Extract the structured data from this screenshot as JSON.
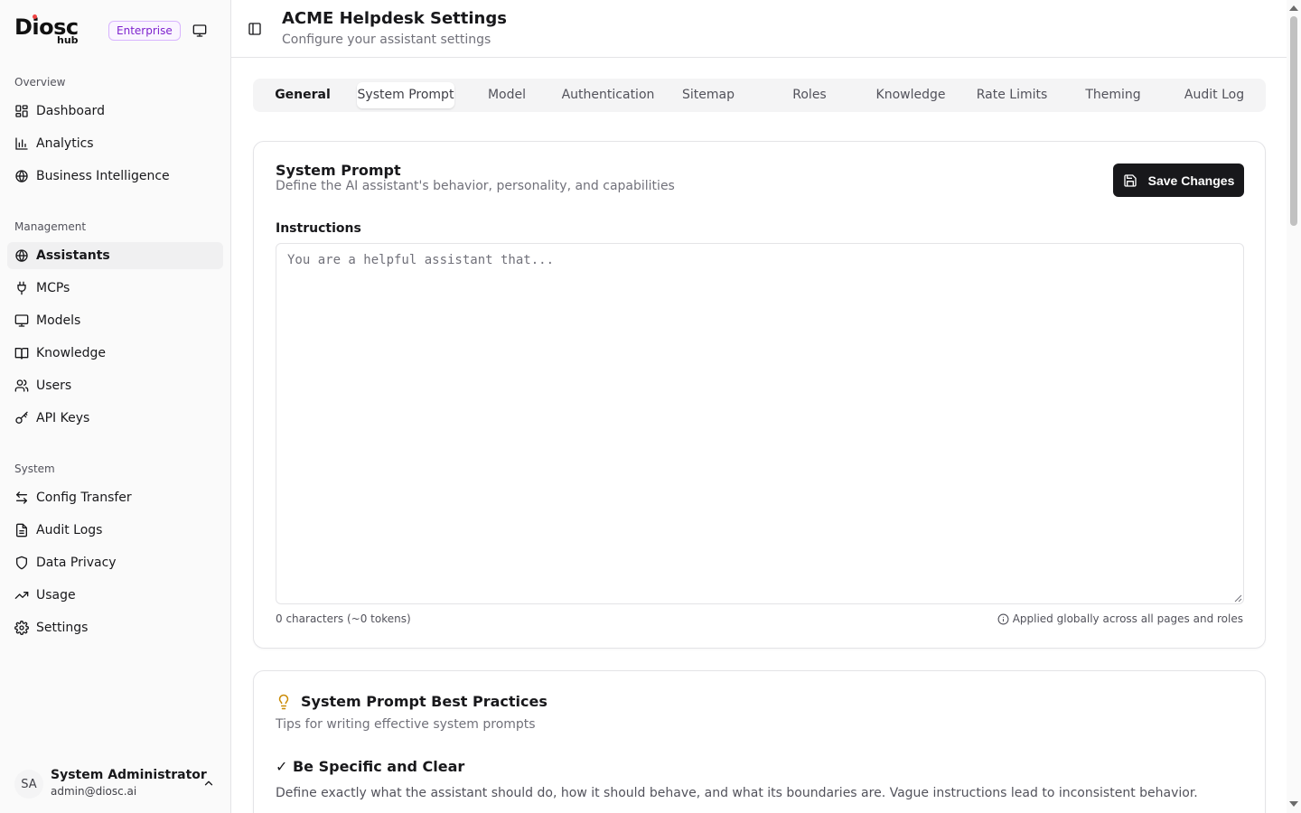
{
  "brand": {
    "name": "Diosc",
    "sub": "hub",
    "edition": "Enterprise"
  },
  "sidebar": {
    "sections": [
      {
        "label": "Overview",
        "items": [
          {
            "label": "Dashboard",
            "icon": "dashboard-icon"
          },
          {
            "label": "Analytics",
            "icon": "bar-chart-icon"
          },
          {
            "label": "Business Intelligence",
            "icon": "globe-icon"
          }
        ]
      },
      {
        "label": "Management",
        "items": [
          {
            "label": "Assistants",
            "icon": "globe-icon",
            "active": true
          },
          {
            "label": "MCPs",
            "icon": "plug-icon"
          },
          {
            "label": "Models",
            "icon": "monitor-icon"
          },
          {
            "label": "Knowledge",
            "icon": "book-icon"
          },
          {
            "label": "Users",
            "icon": "users-icon"
          },
          {
            "label": "API Keys",
            "icon": "key-icon"
          }
        ]
      },
      {
        "label": "System",
        "items": [
          {
            "label": "Config Transfer",
            "icon": "transfer-icon"
          },
          {
            "label": "Audit Logs",
            "icon": "file-text-icon"
          },
          {
            "label": "Data Privacy",
            "icon": "shield-icon"
          },
          {
            "label": "Usage",
            "icon": "trending-up-icon"
          },
          {
            "label": "Settings",
            "icon": "gear-icon"
          }
        ]
      }
    ]
  },
  "user": {
    "initials": "SA",
    "name": "System Administrator",
    "email": "admin@diosc.ai"
  },
  "header": {
    "title": "ACME Helpdesk Settings",
    "subtitle": "Configure your assistant settings"
  },
  "tabs": [
    {
      "label": "General"
    },
    {
      "label": "System Prompt",
      "active": true
    },
    {
      "label": "Model"
    },
    {
      "label": "Authentication"
    },
    {
      "label": "Sitemap"
    },
    {
      "label": "Roles"
    },
    {
      "label": "Knowledge"
    },
    {
      "label": "Rate Limits"
    },
    {
      "label": "Theming"
    },
    {
      "label": "Audit Log"
    }
  ],
  "system_prompt": {
    "title": "System Prompt",
    "description": "Define the AI assistant's behavior, personality, and capabilities",
    "save_label": "Save Changes",
    "field_label": "Instructions",
    "value": "",
    "placeholder": "You are a helpful assistant that...",
    "char_count": "0 characters (~0 tokens)",
    "hint": "Applied globally across all pages and roles"
  },
  "best_practices": {
    "title": "System Prompt Best Practices",
    "description": "Tips for writing effective system prompts",
    "tips": [
      {
        "title": "✓ Be Specific and Clear",
        "body": "Define exactly what the assistant should do, how it should behave, and what its boundaries are. Vague instructions lead to inconsistent behavior."
      }
    ]
  },
  "colors": {
    "primary": "#18181b",
    "enterprise_badge": "#7e22ce",
    "lightbulb": "#ca8a04",
    "brand_dot": "#ef4444"
  }
}
